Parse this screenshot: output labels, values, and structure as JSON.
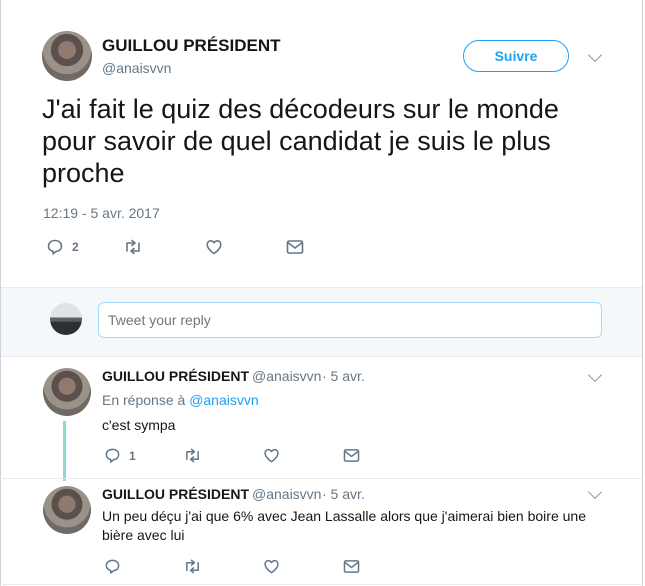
{
  "main_tweet": {
    "display_name": "GUILLOU PRÉSIDENT",
    "handle": "@anaisvvn",
    "follow_label": "Suivre",
    "text": "J'ai fait le quiz des décodeurs sur le monde pour savoir de quel candidat je suis le plus proche",
    "timestamp": "12:19 - 5 avr. 2017",
    "reply_count": "2",
    "icons": [
      "reply-icon",
      "retweet-icon",
      "like-icon",
      "dm-icon",
      "chevron-down-icon"
    ]
  },
  "composer": {
    "placeholder": "Tweet your reply"
  },
  "replies": [
    {
      "display_name": "GUILLOU PRÉSIDENT",
      "handle": "@anaisvvn",
      "date": "· 5 avr.",
      "in_reply_prefix": "En réponse à",
      "in_reply_handle": "@anaisvvn",
      "text": "c'est sympa",
      "reply_count": "1"
    },
    {
      "display_name": "GUILLOU PRÉSIDENT",
      "handle": "@anaisvvn",
      "date": "· 5 avr.",
      "text": "Un peu déçu j'ai que 6% avec Jean Lassalle alors que j'aimerai bien boire une bière avec lui"
    }
  ],
  "colors": {
    "accent": "#1da1f2",
    "muted": "#657786",
    "thread_line": "#8cd9d0"
  }
}
